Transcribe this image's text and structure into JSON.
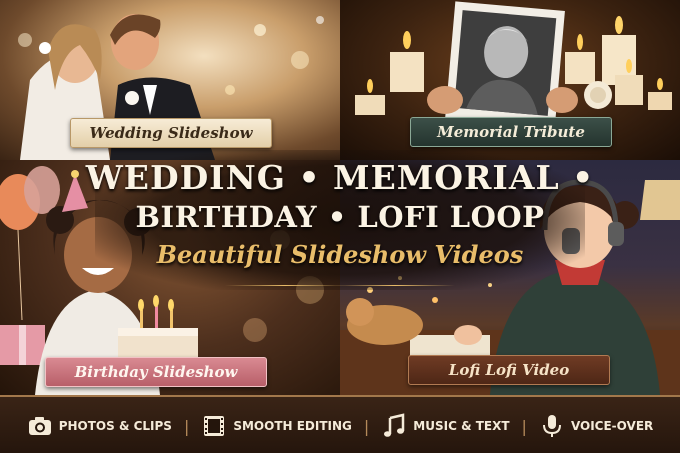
{
  "panels": {
    "wedding": {
      "label": "Wedding Slideshow"
    },
    "memorial": {
      "label": "Memorial Tribute"
    },
    "birthday": {
      "label": "Birthday Slideshow"
    },
    "lofi": {
      "label": "Lofi Lofi Video"
    }
  },
  "headline": {
    "line1": "WEDDING • MEMORIAL •",
    "line2": "BIRTHDAY • LOFI LOOP",
    "subtitle": "Beautiful Slideshow Videos"
  },
  "features": [
    {
      "icon": "camera-icon",
      "label": "PHOTOS & CLIPS"
    },
    {
      "icon": "film-strip-icon",
      "label": "SMOOTH EDITING"
    },
    {
      "icon": "music-note-icon",
      "label": "MUSIC & TEXT"
    },
    {
      "icon": "microphone-icon",
      "label": "VOICE-OVER"
    }
  ],
  "colors": {
    "accent_gold": "#e9bd6a",
    "footer_bg": "#24150c",
    "text_cream": "#fbf3e4"
  }
}
